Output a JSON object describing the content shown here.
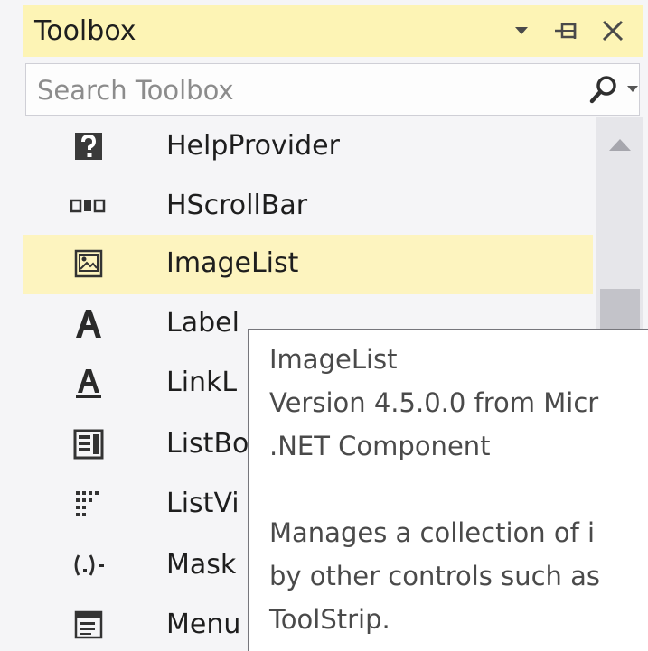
{
  "panel": {
    "title": "Toolbox",
    "dropdown_icon": "triangle-down-icon",
    "pin_icon": "pin-icon",
    "close_icon": "close-icon"
  },
  "search": {
    "placeholder": "Search Toolbox",
    "value": "",
    "icon": "search-icon"
  },
  "items": [
    {
      "label": "HelpProvider",
      "icon": "help-provider-icon"
    },
    {
      "label": "HScrollBar",
      "icon": "hscrollbar-icon"
    },
    {
      "label": "ImageList",
      "icon": "imagelist-icon",
      "selected": true
    },
    {
      "label": "Label",
      "icon": "label-icon"
    },
    {
      "label": "LinkL",
      "icon": "linklabel-icon"
    },
    {
      "label": "ListBo",
      "icon": "listbox-icon"
    },
    {
      "label": "ListVi",
      "icon": "listview-icon"
    },
    {
      "label": "Mask",
      "icon": "maskedtextbox-icon"
    },
    {
      "label": "Menu",
      "icon": "menustrip-icon"
    }
  ],
  "tooltip": {
    "name": "ImageList",
    "version": "Version 4.5.0.0 from Micr",
    "kind": ".NET Component",
    "desc_line1": "Manages a collection of i",
    "desc_line2": "by other controls such as",
    "desc_line3": "ToolStrip."
  },
  "colors": {
    "title_bg": "#fdf4b5",
    "selection_bg": "#fdf4bf",
    "panel_bg": "#f5f5f7"
  }
}
